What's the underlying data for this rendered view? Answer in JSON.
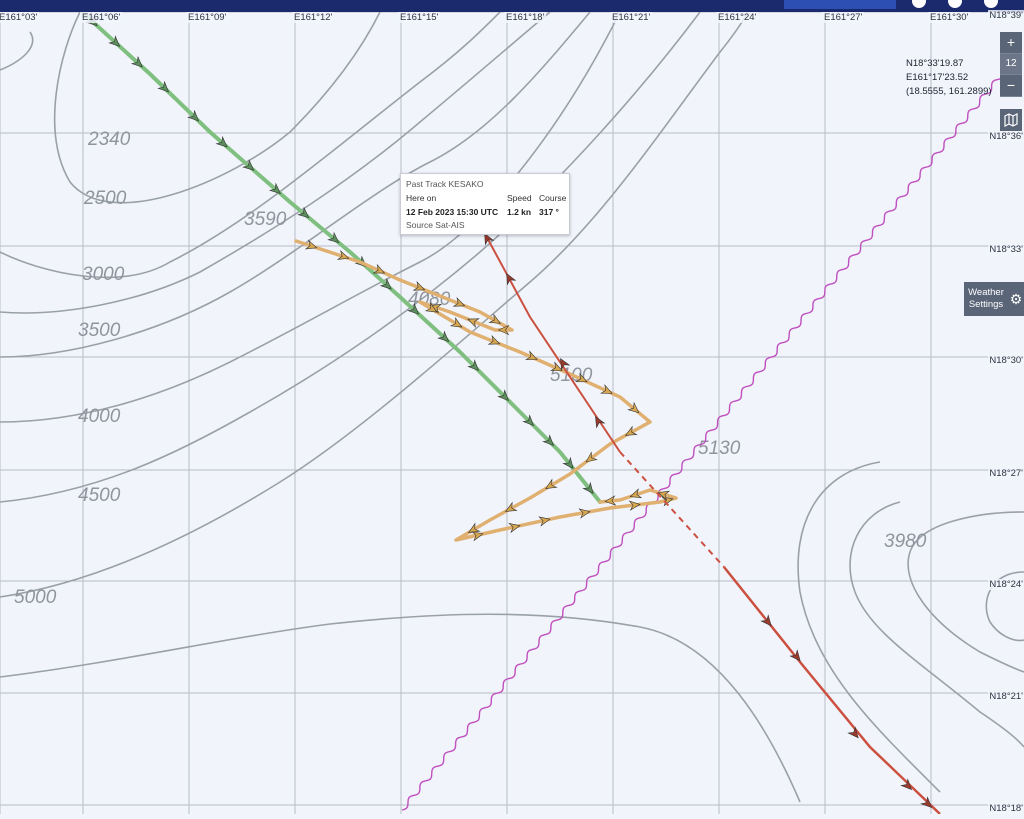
{
  "map": {
    "lon_labels": [
      "E161°03'",
      "E161°06'",
      "E161°09'",
      "E161°12'",
      "E161°15'",
      "E161°18'",
      "E161°21'",
      "E161°24'",
      "E161°27'",
      "E161°30'"
    ],
    "lat_labels": [
      "N18°39'",
      "N18°36'",
      "N18°33'",
      "N18°30'",
      "N18°27'",
      "N18°24'",
      "N18°21'",
      "N18°18'"
    ],
    "depth_labels": [
      "2340",
      "2500",
      "3590",
      "3000",
      "3500",
      "4080",
      "4000",
      "5100",
      "5130",
      "4500",
      "3980",
      "5000"
    ]
  },
  "cursor_readout": {
    "lat": "N18°33'19.87",
    "lon": "E161°17'23.52",
    "decimal": "(18.5555, 161.2899)"
  },
  "zoom": {
    "plus": "+",
    "level": "12",
    "minus": "−"
  },
  "layers": {
    "icon": "map-icon"
  },
  "weather_settings": {
    "label_line1": "Weather",
    "label_line2": "Settings",
    "icon": "gear-icon"
  },
  "popup": {
    "title": "Past Track KESAKO",
    "here_on_label": "Here on",
    "speed_label": "Speed",
    "course_label": "Course",
    "timestamp": "12 Feb 2023 15:30 UTC",
    "speed": "1.2 kn",
    "course": "317 °",
    "source": "Source Sat-AIS"
  },
  "colors": {
    "topbar": "#1a2a6c",
    "green_track": "#7fbf7f",
    "orange_track": "#e0b070",
    "red_track": "#cc5040",
    "purple_line": "#c050c0",
    "contour": "#9aa0a8",
    "grid": "#b8bcc6"
  }
}
